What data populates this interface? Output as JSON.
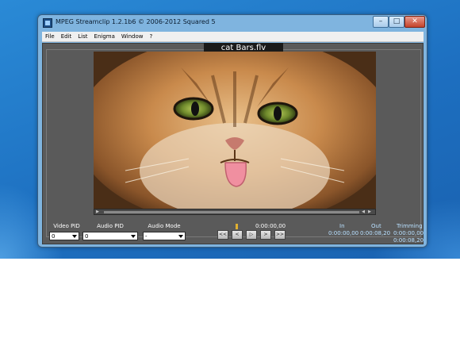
{
  "window": {
    "title": "MPEG Streamclip 1.2.1b6  ©  2006-2012 Squared 5",
    "controls": {
      "minimize": "–",
      "maximize": "□",
      "close": "✕"
    }
  },
  "menu": [
    "File",
    "Edit",
    "List",
    "Enigma",
    "Window",
    "?"
  ],
  "player": {
    "file_name": "cat Bars.flv",
    "current_time": "0:00:00,00",
    "icons": [
      "film-strip-icon",
      "rewind-icon",
      "step-back-icon",
      "play-icon",
      "step-forward-icon",
      "fast-forward-icon"
    ]
  },
  "controls": {
    "video_pid": {
      "label": "Video PID",
      "value": "0"
    },
    "audio_pid": {
      "label": "Audio PID",
      "value": "0"
    },
    "audio_mode": {
      "label": "Audio Mode",
      "value": "-"
    },
    "transport": {
      "rewind": "<<",
      "step_back": "<",
      "play": "▷",
      "step_forward": ">",
      "fast_forward": ">>"
    }
  },
  "timing": {
    "in_label": "In",
    "in_value": "0:00:00,00",
    "out_label": "Out",
    "out_value": "0:00:08,20",
    "trimming_label": "Trimming",
    "trimming_start": "0:00:00,00",
    "trimming_end": "0:00:08,20"
  },
  "colors": {
    "desktop": "#1d6fc0",
    "panel": "#5a5a5a",
    "readout": "#b8e0ff"
  }
}
